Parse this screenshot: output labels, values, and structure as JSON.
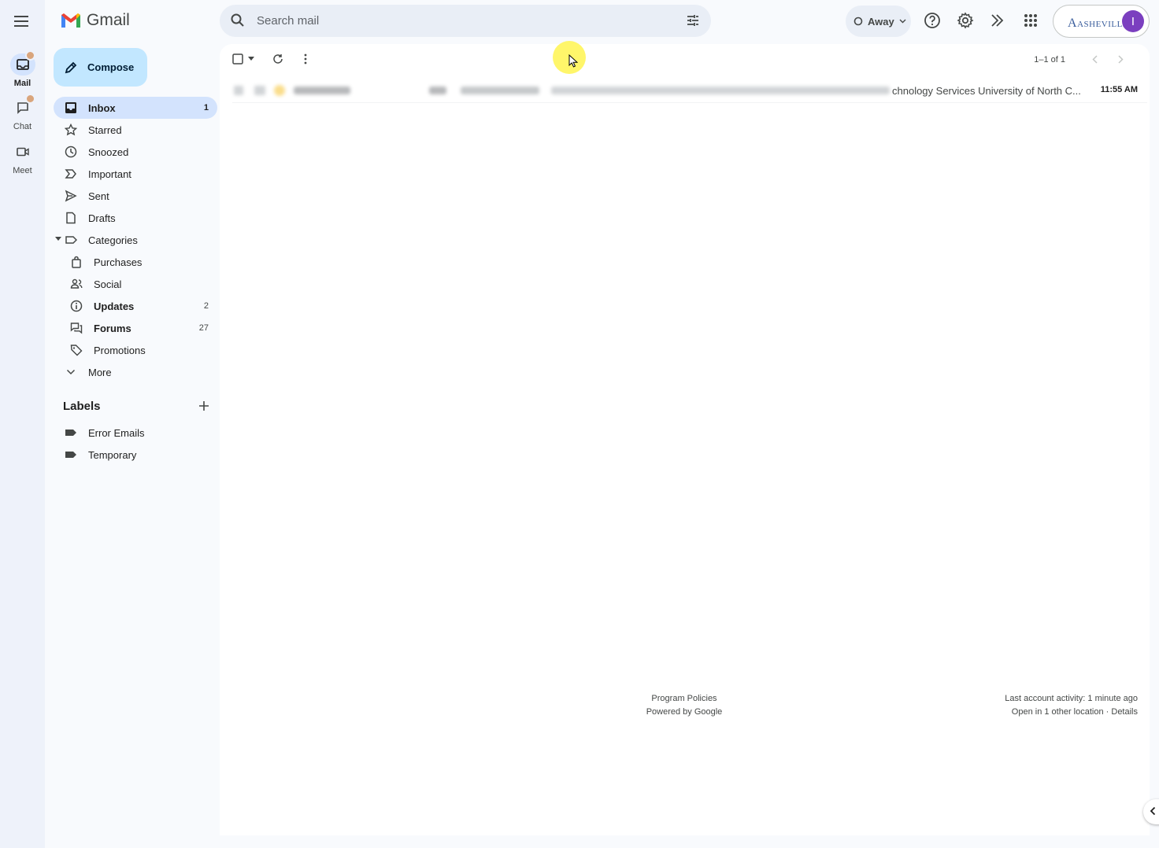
{
  "app": {
    "name": "Gmail"
  },
  "rail": {
    "items": [
      {
        "label": "Mail",
        "icon": "mail-icon",
        "active": true
      },
      {
        "label": "Chat",
        "icon": "chat-icon",
        "active": false
      },
      {
        "label": "Meet",
        "icon": "video-icon",
        "active": false
      }
    ]
  },
  "search": {
    "placeholder": "Search mail",
    "value": ""
  },
  "status": {
    "label": "Away"
  },
  "account": {
    "org_logo_text": "ASHEVILLE",
    "avatar_initial": "I"
  },
  "compose": {
    "label": "Compose"
  },
  "nav": [
    {
      "label": "Inbox",
      "icon": "inbox-icon",
      "count": "1",
      "active": true
    },
    {
      "label": "Starred",
      "icon": "star-icon",
      "count": ""
    },
    {
      "label": "Snoozed",
      "icon": "clock-icon",
      "count": ""
    },
    {
      "label": "Important",
      "icon": "important-icon",
      "count": ""
    },
    {
      "label": "Sent",
      "icon": "send-icon",
      "count": ""
    },
    {
      "label": "Drafts",
      "icon": "draft-icon",
      "count": ""
    },
    {
      "label": "Categories",
      "icon": "label-icon",
      "count": ""
    },
    {
      "label": "Purchases",
      "icon": "bag-icon",
      "count": ""
    },
    {
      "label": "Social",
      "icon": "people-icon",
      "count": ""
    },
    {
      "label": "Updates",
      "icon": "info-icon",
      "count": "2"
    },
    {
      "label": "Forums",
      "icon": "forum-icon",
      "count": "27"
    },
    {
      "label": "Promotions",
      "icon": "tag-icon",
      "count": ""
    },
    {
      "label": "More",
      "icon": "chevron-down-icon",
      "count": ""
    }
  ],
  "labels": {
    "title": "Labels",
    "items": [
      {
        "label": "Error Emails"
      },
      {
        "label": "Temporary"
      }
    ]
  },
  "toolbar": {
    "pager": "1–1 of 1"
  },
  "messages": [
    {
      "snippet": "chnology Services University of North C...",
      "time": "11:55 AM",
      "unread": true
    }
  ],
  "footer": {
    "program_policies": "Program Policies",
    "powered_by": "Powered by Google",
    "last_activity": "Last account activity: 1 minute ago",
    "open_locations": "Open in 1 other location · Details"
  },
  "colors": {
    "background": "#f8fafd",
    "compose_bg": "#c2e7ff",
    "active_nav": "#d3e3fd",
    "avatar": "#7b3fbf",
    "search_bg": "#e9eef6"
  }
}
